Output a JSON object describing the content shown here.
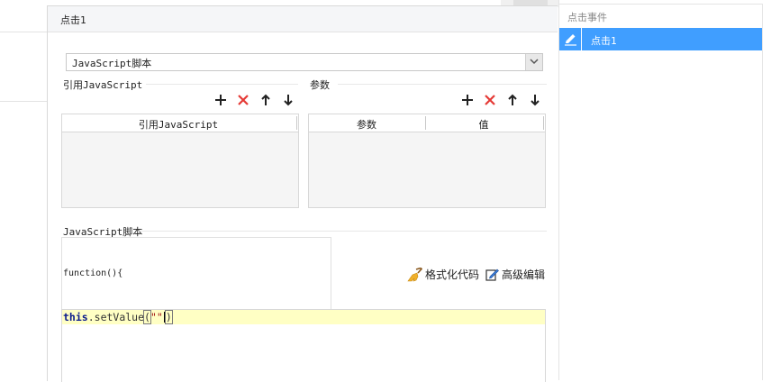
{
  "dialog": {
    "title": "点击1"
  },
  "script_type": {
    "selected": "JavaScript脚本"
  },
  "ref_section": {
    "label": "引用JavaScript",
    "column": "引用JavaScript"
  },
  "param_section": {
    "label": "参数",
    "columns": [
      "参数",
      "值"
    ]
  },
  "script_section": {
    "label": "JavaScript脚本",
    "header_code": "function(){",
    "format_label": "格式化代码",
    "advanced_label": "高级编辑",
    "code_line": {
      "keyword": "this",
      "dot": ".",
      "method": "setValue",
      "open": "(",
      "string": "\"\"",
      "close": ")"
    }
  },
  "events_panel": {
    "header": "点击事件",
    "selected_item": "点击1"
  },
  "colors": {
    "accent": "#409eff",
    "delete": "#e53935",
    "highlight": "#ffffc4"
  }
}
